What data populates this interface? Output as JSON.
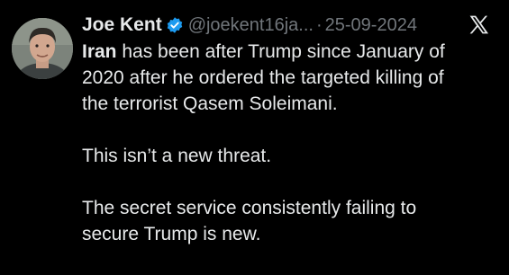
{
  "tweet": {
    "author_name": "Joe Kent",
    "handle": "@joekent16ja...",
    "separator": "·",
    "date": "25-09-2024",
    "paragraph1_bold": "Iran",
    "paragraph1_line1_rest": " has been after Trump since January of",
    "paragraph1_line2": "2020 after he ordered the targeted killing of",
    "paragraph1_line3": "the terrorist Qasem Soleimani.",
    "paragraph2": "This isn’t a new threat.",
    "paragraph3_line1": "The secret service consistently failing to",
    "paragraph3_line2": "secure Trump is new."
  },
  "icons": {
    "verified": "verified-badge-icon",
    "logo": "x-logo-icon",
    "avatar": "profile-photo"
  },
  "colors": {
    "background": "#000000",
    "text": "#e7e9ea",
    "muted": "#71767b",
    "verified": "#1d9bf0"
  }
}
